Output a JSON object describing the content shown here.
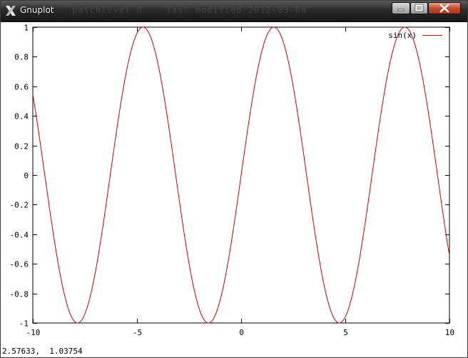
{
  "window": {
    "title": "Gnuplot",
    "ghost_title": "patchlevel 0    last modified 2012-03-04"
  },
  "status": {
    "mouse_coords": "2.57633,  1.03754"
  },
  "colors": {
    "curve": "#cc0000",
    "axis": "#000000"
  },
  "icons": {
    "app": "x-logo-icon",
    "minimize": "minimize-icon",
    "maximize": "maximize-icon",
    "close": "close-icon"
  },
  "chart_data": {
    "type": "line",
    "function": "sin(x)",
    "xlim": [
      -10,
      10
    ],
    "ylim": [
      -1,
      1
    ],
    "xticks": [
      -10,
      -5,
      0,
      5,
      10
    ],
    "xtick_labels": [
      "-10",
      "-5",
      "0",
      "5",
      "10"
    ],
    "yticks": [
      -1,
      -0.8,
      -0.6,
      -0.4,
      -0.2,
      0,
      0.2,
      0.4,
      0.6,
      0.8,
      1
    ],
    "ytick_labels": [
      "-1",
      "-0.8",
      "-0.6",
      "-0.4",
      "-0.2",
      "0",
      "0.2",
      "0.4",
      "0.6",
      "0.8",
      "1"
    ],
    "legend_position": "top-right",
    "grid": false,
    "series": [
      {
        "name": "sin(x)",
        "color": "#cc0000"
      }
    ]
  }
}
